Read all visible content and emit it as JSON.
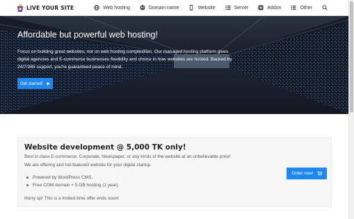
{
  "brand": {
    "name": "LIVE YOUR SITE"
  },
  "nav": {
    "items": [
      {
        "label": "Web hosting",
        "icon": "globe-icon"
      },
      {
        "label": "Domain name",
        "icon": "world-icon"
      },
      {
        "label": "Website",
        "icon": "mobile-icon"
      },
      {
        "label": "Server",
        "icon": "list-icon"
      },
      {
        "label": "Addon",
        "icon": "plus-square-icon"
      },
      {
        "label": "Other",
        "icon": "list-icon"
      }
    ],
    "search_icon": "search-icon"
  },
  "hero": {
    "title": "Affordable but powerful web hosting!",
    "text": "Focus on building great websites, not on web hosting complexities. Our managed hosting platform gives digital agencies and E-commerce businesses flexibility and choice in how websites are hosted. Backed by 24/7/365 support, you're guaranteed peace of mind.",
    "button_label": "Get started!",
    "button_icon": "play-icon"
  },
  "offer": {
    "title": "Website development @ 5,000 TK only!",
    "line1": "Best in class E-commerce, Corporate, Newspaper, or any kinds of the website at an unbelievable price!",
    "line2": "We are offering and full-featured website for your digital startup.",
    "features": [
      "Powered by WordPress CMS.",
      "Free COM domain + 5 GB hosting (1 year)."
    ],
    "footer": "Hurry up! This is a limited-time offer ends soon!",
    "button_label": "Order now!",
    "button_icon": "cart-icon"
  },
  "colors": {
    "accent": "#1e87f0",
    "hero_bg": "#1b2330",
    "offer_bg": "#f6f6f6"
  }
}
